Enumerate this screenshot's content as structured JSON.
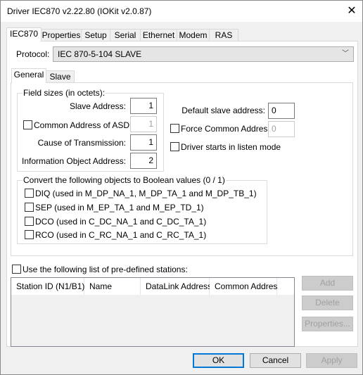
{
  "window": {
    "title": "Driver IEC870 v2.22.80 (IOKit v2.0.87)",
    "close_icon": "close-icon"
  },
  "tabs": [
    "IEC870",
    "Properties",
    "Setup",
    "Serial",
    "Ethernet",
    "Modem",
    "RAS"
  ],
  "protocol": {
    "label": "Protocol:",
    "value": "IEC 870-5-104 SLAVE"
  },
  "inner_tabs": [
    "General",
    "Slave"
  ],
  "field_sizes": {
    "legend": "Field sizes (in octets):",
    "slave_address": {
      "label": "Slave Address:",
      "value": "1"
    },
    "common_address": {
      "label": "Common Address of ASDU:",
      "value": "1",
      "checked": false
    },
    "cause": {
      "label": "Cause of Transmission:",
      "value": "1"
    },
    "ioa": {
      "label": "Information Object Address:",
      "value": "2"
    }
  },
  "default_slave": {
    "label": "Default slave address:",
    "value": "0"
  },
  "force_common": {
    "label": "Force Common Address:",
    "value": "0",
    "checked": false
  },
  "listen_mode": {
    "label": "Driver starts in listen mode",
    "checked": false
  },
  "convert": {
    "legend": "Convert the following objects to Boolean values (0 / 1)",
    "items": [
      {
        "label": "DIQ (used in M_DP_NA_1, M_DP_TA_1 and M_DP_TB_1)",
        "checked": false
      },
      {
        "label": "SEP (used in M_EP_TA_1 and M_EP_TD_1)",
        "checked": false
      },
      {
        "label": "DCO (used in C_DC_NA_1 and C_DC_TA_1)",
        "checked": false
      },
      {
        "label": "RCO (used in C_RC_NA_1 and C_RC_TA_1)",
        "checked": false
      }
    ]
  },
  "stations": {
    "label": "Use the following list of pre-defined stations:",
    "checked": false,
    "columns": [
      "Station ID (N1/B1)",
      "Name",
      "DataLink Address",
      "Common Address"
    ],
    "buttons": {
      "add": "Add",
      "delete": "Delete",
      "properties": "Properties..."
    }
  },
  "footer": {
    "ok": "OK",
    "cancel": "Cancel",
    "apply": "Apply"
  }
}
